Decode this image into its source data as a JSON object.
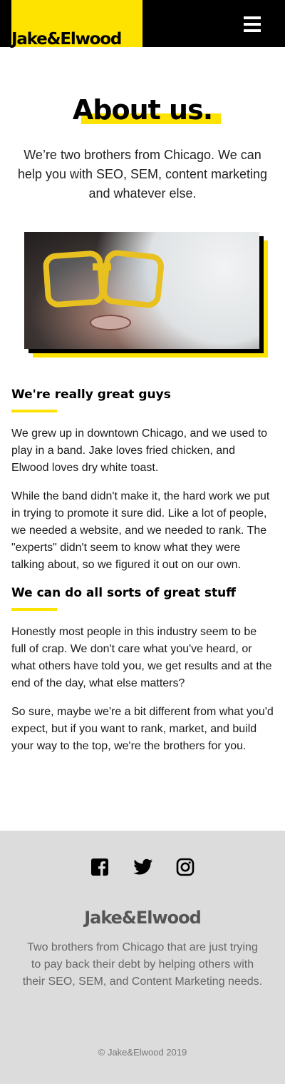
{
  "header": {
    "logo": "Jake&Elwood",
    "menu_icon": "hamburger-menu-icon"
  },
  "hero": {
    "title": "About us.",
    "intro": "We’re two brothers from Chicago. We can help you with SEO, SEM, content marketing and whatever else."
  },
  "photo": {
    "description_icon": "person-with-diving-goggles-image"
  },
  "sections": [
    {
      "heading": "We're really great guys",
      "paragraphs": [
        "We grew up in downtown Chicago, and we used to play in a band. Jake loves fried chicken, and Elwood loves dry white toast.",
        "While the band didn't make it, the hard work we put in trying to promote it sure did. Like a lot of people, we needed a website, and we needed to rank. The \"experts\" didn't seem to know what they were talking about, so we figured it out on our own."
      ]
    },
    {
      "heading": "We can do all sorts of great stuff",
      "paragraphs": [
        "Honestly most people in this industry seem to be full of crap. We don't care what you've heard, or what others have told you, we get results and at the end of the day, what else matters?",
        "So sure, maybe we're a bit different from what you'd expect, but if you want to rank, market, and build your way to the top, we're the brothers for you."
      ]
    }
  ],
  "footer": {
    "social_icons": [
      "facebook-icon",
      "twitter-icon",
      "instagram-icon"
    ],
    "logo": "Jake&Elwood",
    "description": "Two brothers from Chicago that are just trying to pay back their debt by helping others with their SEO, SEM, and Content Marketing needs.",
    "copyright": "© Jake&Elwood 2019"
  },
  "colors": {
    "accent": "#FFE300",
    "header_bg": "#000000",
    "footer_bg": "#dcdcdc"
  }
}
